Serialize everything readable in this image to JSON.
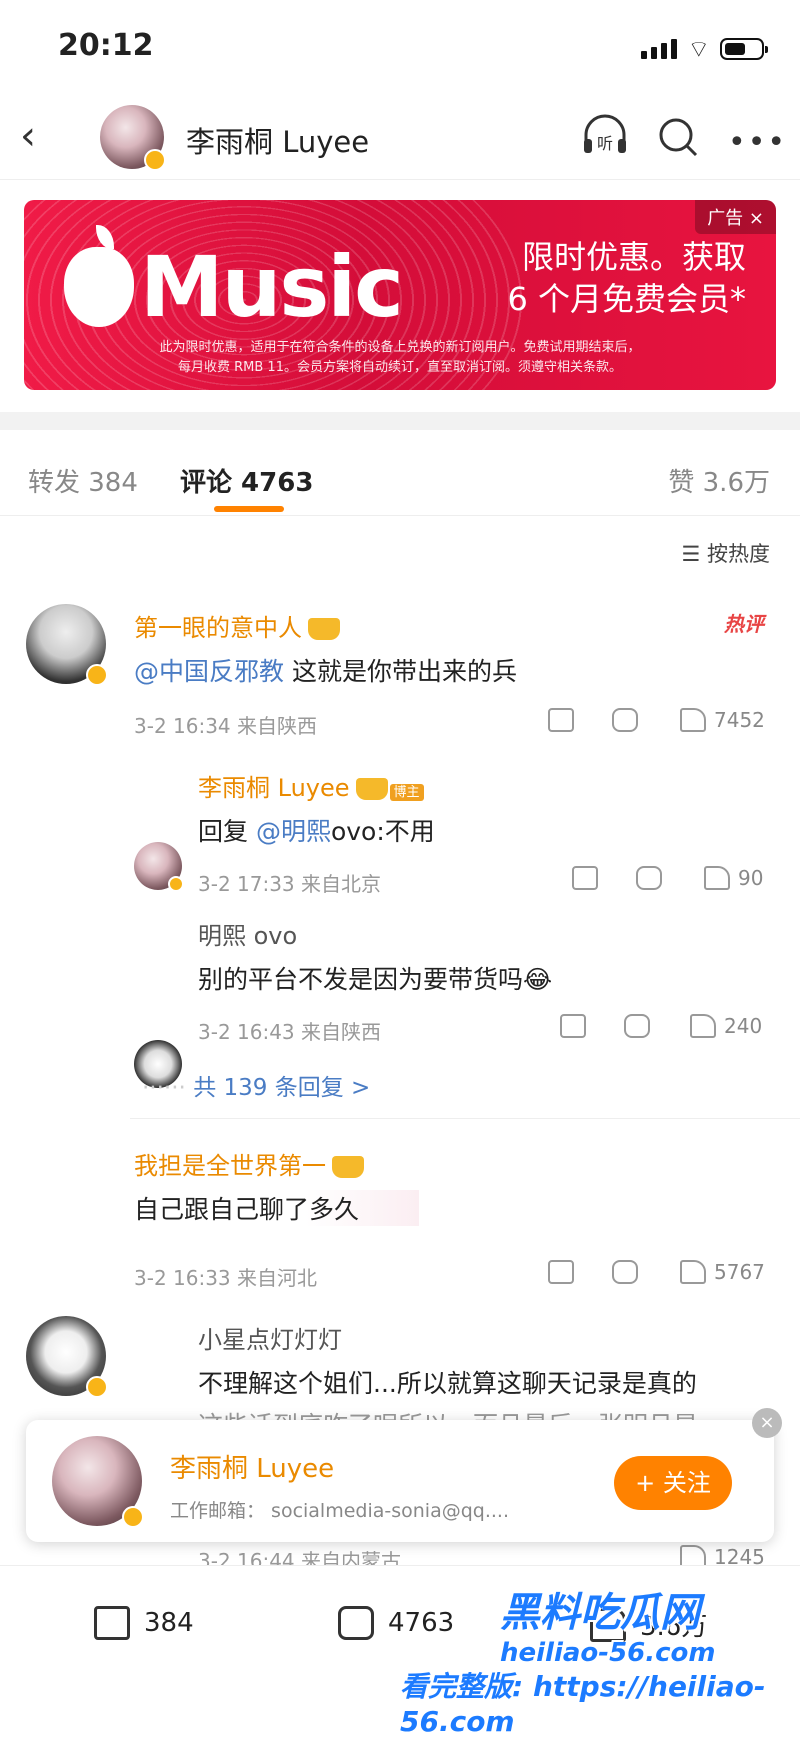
{
  "status": {
    "time": "20:12"
  },
  "nav": {
    "title": "李雨桐 Luyee",
    "listen_label": "听"
  },
  "ad": {
    "tag": "广告 ×",
    "logo": "Music",
    "headline1": "限时优惠。获取",
    "headline2": "6 个月免费会员*",
    "fine1": "此为限时优惠，适用于在符合条件的设备上兑换的新订阅用户。免费试用期结束后，",
    "fine2": "每月收费 RMB 11。会员方案将自动续订，直至取消订阅。须遵守相关条款。"
  },
  "tabs": {
    "repost": "转发 384",
    "comment": "评论 4763",
    "like": "赞 3.6万"
  },
  "sort": {
    "label": "按热度"
  },
  "comments": [
    {
      "user": "第一眼的意中人",
      "hot": "热评",
      "mention": "@中国反邪教",
      "text": " 这就是你带出来的兵",
      "meta": "3-2 16:34 来自陕西",
      "likes": "7452",
      "replies": [
        {
          "user": "李雨桐 Luyee",
          "tag": "博主",
          "prefix": "回复 ",
          "mention": "@明熙",
          "text": "ovo:不用",
          "meta": "3-2 17:33 来自北京",
          "likes": "90"
        },
        {
          "user": "明熙 ovo",
          "text": "别的平台不发是因为要带货吗😂",
          "meta": "3-2 16:43 来自陕西",
          "likes": "240"
        }
      ],
      "more_replies": "共 139 条回复 >"
    },
    {
      "user": "我担是全世界第一",
      "text": "自己跟自己聊了多久",
      "meta": "3-2 16:33 来自河北",
      "likes": "5767",
      "replies": [
        {
          "user": "小星点灯灯灯",
          "text": "不理解这个姐们...所以就算这聊天记录是真的",
          "text2": "这些话到底咋了呢所以，而且最后，张明月是",
          "meta": "3-2 16:44 来自内蒙古",
          "likes": "1245"
        }
      ]
    }
  ],
  "floating": {
    "name": "李雨桐 Luyee",
    "email": "工作邮箱： socialmedia-sonia@qq....",
    "follow": "+ 关注",
    "close": "×"
  },
  "bottom": {
    "repost": "384",
    "comment": "4763",
    "like": "3.6万"
  },
  "watermark": {
    "line1": "黑料吃瓜网",
    "line2": "heiliao-56.com",
    "line3": "看完整版: https://heiliao-56.com"
  }
}
